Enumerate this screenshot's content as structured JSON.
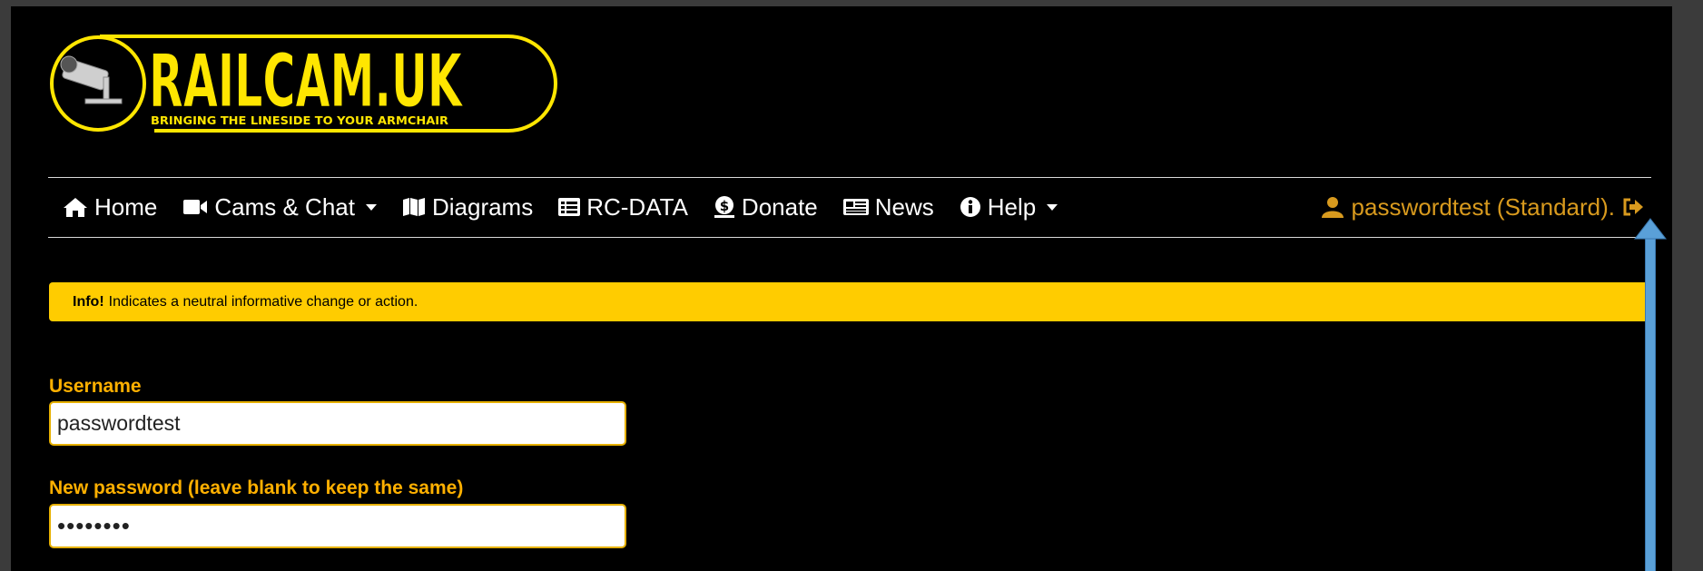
{
  "logo": {
    "title": "RAILCAM.UK",
    "tagline": "BRINGING THE LINESIDE TO YOUR ARMCHAIR"
  },
  "nav": {
    "items": [
      {
        "label": "Home",
        "icon": "home-icon"
      },
      {
        "label": "Cams & Chat",
        "icon": "video-camera-icon",
        "dropdown": true
      },
      {
        "label": "Diagrams",
        "icon": "map-icon"
      },
      {
        "label": "RC-DATA",
        "icon": "table-list-icon"
      },
      {
        "label": "Donate",
        "icon": "donate-coin-icon"
      },
      {
        "label": "News",
        "icon": "newspaper-icon"
      },
      {
        "label": "Help",
        "icon": "info-circle-icon",
        "dropdown": true
      }
    ],
    "user": {
      "label": "passwordtest (Standard).",
      "icon": "user-icon",
      "logout_icon": "logout-icon"
    }
  },
  "alert": {
    "strong": "Info!",
    "text": "Indicates a neutral informative change or action."
  },
  "form": {
    "username_label": "Username",
    "username_value": "passwordtest",
    "password_label": "New password (leave blank to keep the same)",
    "password_value": "••••••••"
  },
  "colors": {
    "background": "#000000",
    "accent": "#ffb000",
    "alert_bg": "#ffcc00",
    "user_link": "#d89a1e",
    "annotation_arrow": "#5aa0d8"
  }
}
